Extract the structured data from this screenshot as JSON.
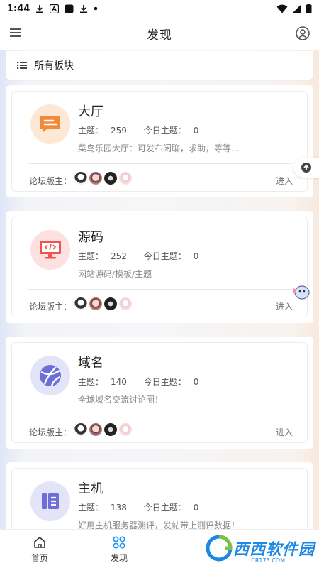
{
  "status_bar": {
    "time": "1:44"
  },
  "app_bar": {
    "title": "发现"
  },
  "section": {
    "title": "所有板块"
  },
  "forums": [
    {
      "name": "大厅",
      "topics_label": "主题：",
      "topics": "259",
      "today_label": "今日主题：",
      "today": "0",
      "description": "菜鸟乐园大厅：可发布闲聊，求助，等等...",
      "icon": "chat-bubble-icon",
      "icon_bg": "#fde8d6",
      "icon_color": "#f08a3c"
    },
    {
      "name": "源码",
      "topics_label": "主题：",
      "topics": "252",
      "today_label": "今日主题：",
      "today": "0",
      "description": "网站源码/模板/主题",
      "icon": "monitor-code-icon",
      "icon_bg": "#fde0e0",
      "icon_color": "#ef5350"
    },
    {
      "name": "域名",
      "topics_label": "主题：",
      "topics": "140",
      "today_label": "今日主题：",
      "today": "0",
      "description": "全球域名交流讨论圈！",
      "icon": "globe-icon",
      "icon_bg": "#e3e4f8",
      "icon_color": "#6c6fd8"
    },
    {
      "name": "主机",
      "topics_label": "主题：",
      "topics": "138",
      "today_label": "今日主题：",
      "today": "0",
      "description": "好用主机服务器测评，发帖带上测评数据！",
      "icon": "server-icon",
      "icon_bg": "#e3e4f8",
      "icon_color": "#6c6fd8"
    }
  ],
  "moderators": {
    "label": "论坛版主："
  },
  "enter_label": "进入",
  "bottom_nav": [
    {
      "label": "首页",
      "icon": "home-icon"
    },
    {
      "label": "发现",
      "icon": "grid-icon"
    }
  ],
  "watermark": {
    "text": "西西软件园",
    "sub": "CR173.COM"
  },
  "colors": {
    "accent": "#1e88e5",
    "card_bg": "#ffffff",
    "divider": "#e8e8e8"
  }
}
